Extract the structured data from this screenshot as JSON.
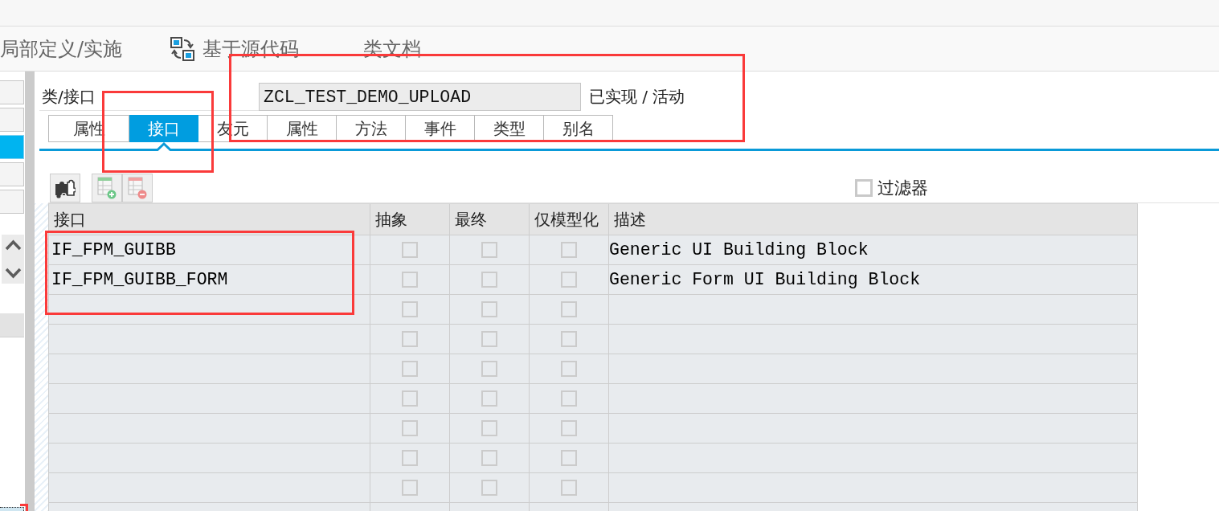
{
  "toolbar": {
    "items": [
      {
        "kind": "text",
        "label": "局部定义/实施"
      },
      {
        "kind": "icon_text",
        "label": "基于源代码"
      },
      {
        "kind": "text",
        "label": "类文档"
      }
    ]
  },
  "side_panel": {
    "tiles": [
      {
        "selected": false
      },
      {
        "selected": false
      },
      {
        "selected": true
      },
      {
        "selected": false
      },
      {
        "selected": false
      }
    ],
    "bottom_item": {
      "focused": true
    }
  },
  "header": {
    "label": "类/接口",
    "class_name": "ZCL_TEST_DEMO_UPLOAD",
    "status": "已实现 / 活动"
  },
  "tabs": [
    {
      "label": "属性",
      "selected": false
    },
    {
      "label": "接口",
      "selected": true
    },
    {
      "label": "友元",
      "selected": false
    },
    {
      "label": "属性",
      "selected": false
    },
    {
      "label": "方法",
      "selected": false
    },
    {
      "label": "事件",
      "selected": false
    },
    {
      "label": "类型",
      "selected": false
    },
    {
      "label": "别名",
      "selected": false
    }
  ],
  "table_toolbar": {
    "buttons": [
      {
        "kind": "interfaces"
      },
      {
        "kind": "insert_row"
      },
      {
        "kind": "delete_row"
      }
    ],
    "filter": {
      "label": "过滤器",
      "checked": false
    }
  },
  "table": {
    "columns": [
      {
        "label": "接口",
        "kind": "text"
      },
      {
        "label": "抽象",
        "kind": "checkbox"
      },
      {
        "label": "最终",
        "kind": "checkbox"
      },
      {
        "label": "仅模型化",
        "kind": "checkbox"
      },
      {
        "label": "描述",
        "kind": "text"
      }
    ],
    "rows": [
      {
        "interface": "IF_FPM_GUIBB",
        "abstract": false,
        "final": false,
        "modeled_only": false,
        "description": "Generic UI Building Block"
      },
      {
        "interface": "IF_FPM_GUIBB_FORM",
        "abstract": false,
        "final": false,
        "modeled_only": false,
        "description": "Generic Form UI Building Block"
      },
      {
        "abstract": false,
        "final": false,
        "modeled_only": false
      },
      {
        "abstract": false,
        "final": false,
        "modeled_only": false
      },
      {
        "abstract": false,
        "final": false,
        "modeled_only": false
      },
      {
        "abstract": false,
        "final": false,
        "modeled_only": false
      },
      {
        "abstract": false,
        "final": false,
        "modeled_only": false
      },
      {
        "abstract": false,
        "final": false,
        "modeled_only": false
      },
      {
        "abstract": false,
        "final": false,
        "modeled_only": false
      }
    ]
  },
  "highlight_frames": [
    {
      "kind": "class_name"
    },
    {
      "kind": "selected_tab"
    },
    {
      "kind": "interface_rows"
    },
    {
      "kind": "left_corner"
    }
  ]
}
